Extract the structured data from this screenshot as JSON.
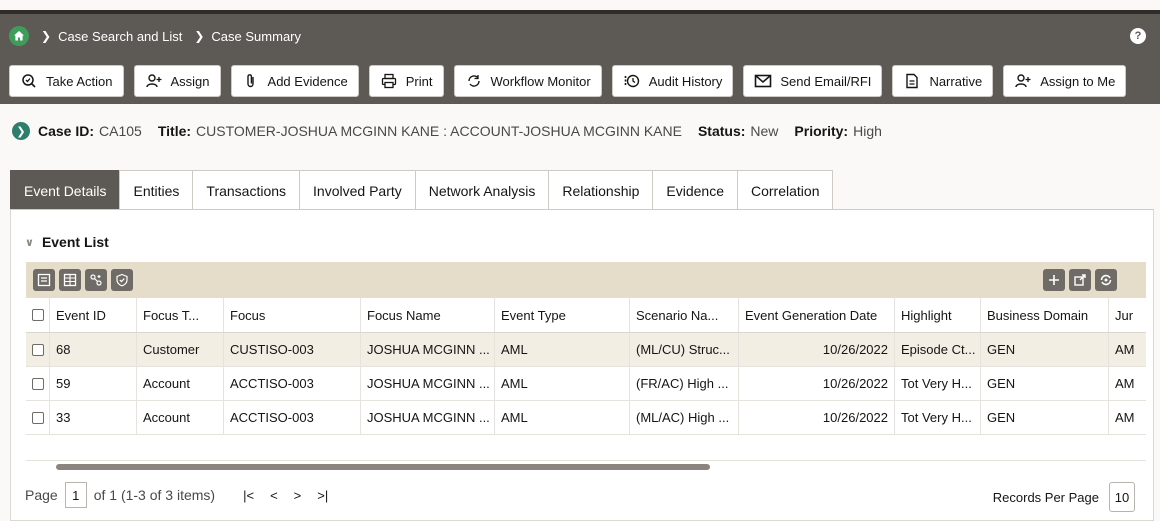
{
  "breadcrumb": {
    "items": [
      "Case Search and List",
      "Case Summary"
    ]
  },
  "header": {
    "help_label": "?"
  },
  "toolbar": {
    "buttons": [
      {
        "label": "Take Action",
        "icon": "take-action-icon"
      },
      {
        "label": "Assign",
        "icon": "assign-user-icon"
      },
      {
        "label": "Add Evidence",
        "icon": "paperclip-icon"
      },
      {
        "label": "Print",
        "icon": "print-icon"
      },
      {
        "label": "Workflow Monitor",
        "icon": "workflow-icon"
      },
      {
        "label": "Audit History",
        "icon": "history-icon"
      },
      {
        "label": "Send Email/RFI",
        "icon": "email-icon"
      },
      {
        "label": "Narrative",
        "icon": "document-icon"
      },
      {
        "label": "Assign to Me",
        "icon": "assign-me-icon"
      }
    ]
  },
  "case": {
    "id_label": "Case ID:",
    "id": "CA105",
    "title_label": "Title:",
    "title": "CUSTOMER-JOSHUA MCGINN KANE : ACCOUNT-JOSHUA MCGINN KANE",
    "status_label": "Status:",
    "status": "New",
    "priority_label": "Priority:",
    "priority": "High"
  },
  "tabs": [
    "Event Details",
    "Entities",
    "Transactions",
    "Involved Party",
    "Network Analysis",
    "Relationship",
    "Evidence",
    "Correlation"
  ],
  "event_list": {
    "title": "Event List",
    "columns": [
      "Event ID",
      "Focus T...",
      "Focus",
      "Focus Name",
      "Event Type",
      "Scenario Na...",
      "Event Generation Date",
      "Highlight",
      "Business Domain",
      "Jur"
    ],
    "rows": [
      [
        "68",
        "Customer",
        "CUSTISO-003",
        "JOSHUA MCGINN ...",
        "AML",
        "(ML/CU) Struc...",
        "10/26/2022",
        "Episode Ct...",
        "GEN",
        "AM"
      ],
      [
        "59",
        "Account",
        "ACCTISO-003",
        "JOSHUA MCGINN ...",
        "AML",
        "(FR/AC) High ...",
        "10/26/2022",
        "Tot Very H...",
        "GEN",
        "AM"
      ],
      [
        "33",
        "Account",
        "ACCTISO-003",
        "JOSHUA MCGINN ...",
        "AML",
        "(ML/AC) High ...",
        "10/26/2022",
        "Tot Very H...",
        "GEN",
        "AM"
      ]
    ]
  },
  "pager": {
    "page_label": "Page",
    "page_value": "1",
    "summary": "of 1 (1-3 of 3 items)",
    "records_label": "Records Per Page",
    "records_value": "10"
  },
  "colors": {
    "header_bg": "#5d5954",
    "gridbar_bg": "#e5ddc9",
    "row_alt": "#f3eee4",
    "home": "#3f9d5c"
  }
}
